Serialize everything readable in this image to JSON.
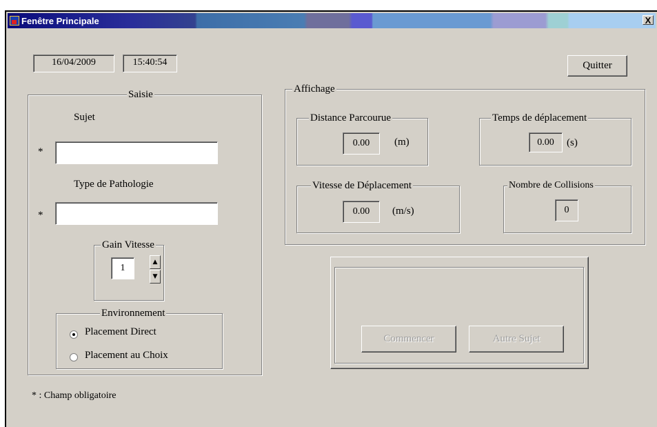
{
  "window": {
    "title": "Fenêtre Principale",
    "close_label": "X"
  },
  "header": {
    "date": "16/04/2009",
    "time": "15:40:54",
    "quit_label": "Quitter"
  },
  "saisie": {
    "legend": "Saisie",
    "sujet_label": "Sujet",
    "sujet_value": "",
    "pathologie_label": "Type de Pathologie",
    "pathologie_value": "",
    "required_marker": "*",
    "gain": {
      "legend": "Gain Vitesse",
      "value": "1"
    },
    "environnement": {
      "legend": "Environnement",
      "options": [
        {
          "label": "Placement Direct",
          "selected": true
        },
        {
          "label": "Placement au Choix",
          "selected": false
        }
      ]
    }
  },
  "affichage": {
    "legend": "Affichage",
    "distance": {
      "legend": "Distance Parcourue",
      "value": "0.00",
      "unit": "(m)"
    },
    "temps": {
      "legend": "Temps de déplacement",
      "value": "0.00",
      "unit": "(s)"
    },
    "vitesse": {
      "legend": "Vitesse de Déplacement",
      "value": "0.00",
      "unit": "(m/s)"
    },
    "collisions": {
      "legend": "Nombre de Collisions",
      "value": "0"
    }
  },
  "actions": {
    "start_label": "Commencer",
    "next_label": "Autre Sujet"
  },
  "footer": {
    "note": "* : Champ obligatoire"
  },
  "icons": {
    "up": "▲",
    "down": "▼"
  }
}
